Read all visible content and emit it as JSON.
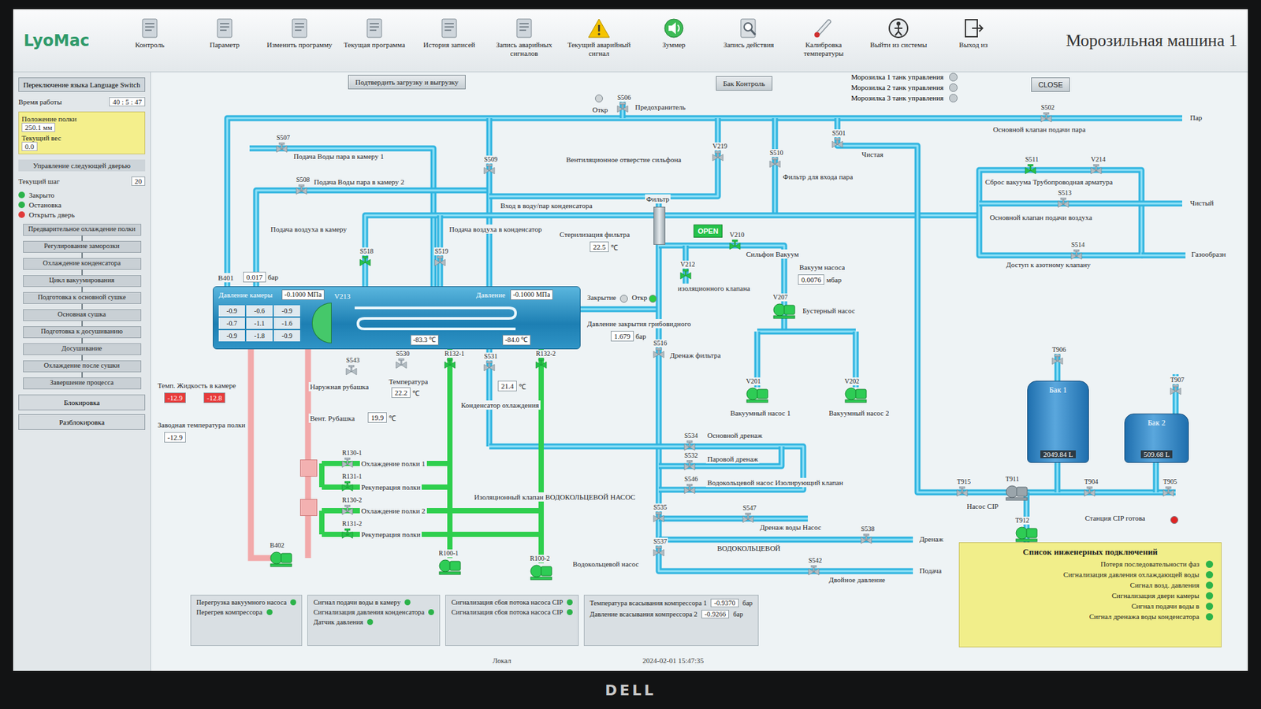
{
  "window": {
    "logo": "LyoMac",
    "title": "Морозильная машина 1"
  },
  "toolbar": [
    {
      "label": "Контроль",
      "kind": "doc"
    },
    {
      "label": "Параметр",
      "kind": "doc"
    },
    {
      "label": "Изменить программу",
      "kind": "doc"
    },
    {
      "label": "Текущая программа",
      "kind": "doc"
    },
    {
      "label": "История записей",
      "kind": "doc"
    },
    {
      "label": "Запись аварийных сигналов",
      "kind": "doc"
    },
    {
      "label": "Текущий аварийный сигнал",
      "kind": "warning"
    },
    {
      "label": "Зуммер",
      "kind": "speaker"
    },
    {
      "label": "Запись действия",
      "kind": "search"
    },
    {
      "label": "Калибровка температуры",
      "kind": "thermometer"
    },
    {
      "label": "Выйти из системы",
      "kind": "exit"
    },
    {
      "label": "Выход из",
      "kind": "door"
    }
  ],
  "controls": {
    "confirm": "Подтвердить загрузку и выгрузку",
    "tank_control": "Бак Контроль",
    "close": "CLOSE",
    "open_badge": "OPEN"
  },
  "tank_modes": [
    {
      "label": "Морозилка 1 танк управления",
      "selected": false
    },
    {
      "label": "Морозилка 2 танк управления",
      "selected": false
    },
    {
      "label": "Морозилка 3 танк управления",
      "selected": false
    }
  ],
  "left_panel": {
    "language": "Переключение языка Language Switch",
    "runtime_label": "Время работы",
    "runtime": "40 : 5 : 47",
    "info": [
      {
        "label": "Положение полки",
        "value": "250.1 мм"
      },
      {
        "label": "Текущий вес",
        "value": "0.0"
      }
    ],
    "section": "Управление следующей дверью",
    "current_step_label": "Текущий шаг",
    "current_step": "20",
    "lights": [
      {
        "label": "Закрыто",
        "color": "#2bb34a"
      },
      {
        "label": "Остановка",
        "color": "#2bb34a"
      },
      {
        "label": "Открыть дверь",
        "color": "#e03a3a"
      }
    ],
    "steps": [
      "Предварительное охлаждение полки",
      "Регулирование заморозки",
      "Охлаждение конденсатора",
      "Цикл вакуумирования",
      "Подготовка к основной сушке",
      "Основная сушка",
      "Подготовка к досушиванию",
      "Досушивание",
      "Охлаждение после сушки",
      "Завершение процесса"
    ],
    "lock": [
      "Блокировка",
      "Разблокировка"
    ]
  },
  "valves": [
    {
      "tag": "S506",
      "on": false
    },
    {
      "tag": "S502",
      "on": false
    },
    {
      "tag": "S501",
      "on": false
    },
    {
      "tag": "V219",
      "on": false
    },
    {
      "tag": "S510",
      "on": false
    },
    {
      "tag": "S511",
      "on": true
    },
    {
      "tag": "V214",
      "on": false
    },
    {
      "tag": "S513",
      "on": false
    },
    {
      "tag": "S514",
      "on": false
    },
    {
      "tag": "S507",
      "on": false
    },
    {
      "tag": "S508",
      "on": false
    },
    {
      "tag": "S509",
      "on": false
    },
    {
      "tag": "S518",
      "on": true
    },
    {
      "tag": "S519",
      "on": false
    },
    {
      "tag": "V210",
      "on": true
    },
    {
      "tag": "V212",
      "on": true
    },
    {
      "tag": "S516",
      "on": false
    },
    {
      "tag": "S530",
      "on": false
    },
    {
      "tag": "S531",
      "on": false
    },
    {
      "tag": "S543",
      "on": false
    },
    {
      "tag": "S534",
      "on": false
    },
    {
      "tag": "S532",
      "on": false
    },
    {
      "tag": "S546",
      "on": false
    },
    {
      "tag": "S535",
      "on": false
    },
    {
      "tag": "S547",
      "on": false
    },
    {
      "tag": "S537",
      "on": false
    },
    {
      "tag": "S538",
      "on": false
    },
    {
      "tag": "S542",
      "on": false
    },
    {
      "tag": "T906",
      "on": false
    },
    {
      "tag": "T907",
      "on": false
    },
    {
      "tag": "T915",
      "on": false
    },
    {
      "tag": "T904",
      "on": false
    },
    {
      "tag": "T905",
      "on": false
    },
    {
      "tag": "R130-1",
      "on": false
    },
    {
      "tag": "R131-1",
      "on": true
    },
    {
      "tag": "R130-2",
      "on": false
    },
    {
      "tag": "R131-2",
      "on": true
    },
    {
      "tag": "R132-1",
      "on": true
    },
    {
      "tag": "R132-2",
      "on": true
    }
  ],
  "pumps": [
    {
      "tag": "V207",
      "on": true
    },
    {
      "tag": "V201",
      "on": true
    },
    {
      "tag": "V202",
      "on": true
    },
    {
      "tag": "T911",
      "on": false
    },
    {
      "tag": "T912",
      "on": true
    },
    {
      "tag": "R100-1",
      "on": true
    },
    {
      "tag": "R100-2",
      "on": true
    },
    {
      "tag": "B402",
      "on": true
    }
  ],
  "labels": [
    "Откр",
    "Предохранитель",
    "Пар",
    "Основной клапан подачи пара",
    "Чистая",
    "Вентиляционное отверстие сильфона",
    "Фильтр для входа пара",
    "Сброс вакуума Трубопроводная арматура",
    "Основной клапан подачи воздуха",
    "Чистый",
    "Доступ к азотному клапану",
    "Газообразн",
    "Подача Воды пара в камеру 1",
    "Подача Воды пара в камеру 2",
    "Вход в воду/пар конденсатора",
    "Фильтр",
    "Подача воздуха в камеру",
    "Подача воздуха в конденсатор",
    "Стерилизация фильтра",
    "Сильфон Вакуум",
    "изоляционного клапана",
    "Вакуум насоса",
    "Бустерный насос",
    "Вакуумный насос 1",
    "Вакуумный насос 2",
    "Дренаж фильтра",
    "Давление закрытия грибовидного",
    "Закрытие",
    "Откр",
    "Температура",
    "Конденсатор охлаждения",
    "Наружная рубашка",
    "Вент. Рубашка",
    "Темп. Жидкость в камере",
    "Заводная температура полки",
    "Охлаждение полки 1",
    "Рекуперация полки",
    "Охлаждение полки 2",
    "Рекуперация полки",
    "Изоляционный клапан ВОДОКОЛЬЦЕВОЙ НАСОС",
    "Водокольцевой насос",
    "Основной дренаж",
    "Паровой дренаж",
    "Водокольцевой насос Изолирующий клапан",
    "Дренаж воды Насос",
    "ВОДОКОЛЬЦЕВОЙ",
    "Двойное давление",
    "Дренаж",
    "Подача",
    "Станция CIP готова",
    "Насос CIP",
    "B401"
  ],
  "readouts": [
    {
      "value": "22.5",
      "unit": "℃",
      "alarm": false
    },
    {
      "value": "0.0076",
      "unit": "мбар",
      "alarm": false
    },
    {
      "value": "1.679",
      "unit": "бар",
      "alarm": false
    },
    {
      "value": "22.2",
      "unit": "℃",
      "alarm": false
    },
    {
      "value": "21.4",
      "unit": "℃",
      "alarm": false
    },
    {
      "value": "19.9",
      "unit": "℃",
      "alarm": false
    },
    {
      "value": "-12.9",
      "unit": "",
      "alarm": true
    },
    {
      "value": "-12.8",
      "unit": "",
      "alarm": true
    },
    {
      "value": "-12.9",
      "unit": "",
      "alarm": false
    },
    {
      "value": "0.017",
      "unit": "бар",
      "alarm": false
    }
  ],
  "indicators": [
    {
      "color": "#cfd4d6"
    },
    {
      "color": "#cfd4d6"
    },
    {
      "color": "#2ecc40"
    },
    {
      "color": "#e02424"
    }
  ],
  "chamber": {
    "pressure_label": "Давление камеры",
    "pressure": {
      "value": "-0.1000",
      "unit": "МПа"
    },
    "valve": "V213",
    "cond_label": "Давление",
    "cond_pressure": {
      "value": "-0.1000",
      "unit": "МПа"
    },
    "temps": [
      "-0.9",
      "-0.6",
      "-0.9",
      "-0.7",
      "-1.1",
      "-1.6",
      "-0.9",
      "-1.8",
      "-0.9"
    ],
    "cond_temps": [
      {
        "value": "-83.3",
        "unit": "℃"
      },
      {
        "value": "-84.0",
        "unit": "℃"
      }
    ]
  },
  "tanks": [
    {
      "name": "Бак 1",
      "value": "2049.84",
      "unit": "L"
    },
    {
      "name": "Бак 2",
      "value": "509.68",
      "unit": "L"
    }
  ],
  "alarm_panels": [
    [
      {
        "text": "Перегрузка вакуумного насоса",
        "color": "#2cb34a"
      },
      {
        "text": "Перегрев компрессора",
        "color": "#2cb34a"
      }
    ],
    [
      {
        "text": "Сигнал подачи воды в камеру",
        "color": "#2cb34a"
      },
      {
        "text": "Сигнализация давления конденсатора",
        "color": "#2cb34a"
      },
      {
        "text": "Датчик давления",
        "color": "#2cb34a"
      }
    ],
    [
      {
        "text": "Сигнализация сбоя потока насоса CIP",
        "color": "#2cb34a"
      },
      {
        "text": "Сигнализация сбоя потока насоса CIP",
        "color": "#2cb34a"
      }
    ]
  ],
  "compressor": [
    {
      "label": "Температура всасывания компрессора 1",
      "value": "-0.9370",
      "unit": "бар"
    },
    {
      "label": "Давление всасывания компрессора 2",
      "value": "-0.9266",
      "unit": "бар"
    }
  ],
  "engineering": {
    "title": "Список инженерных подключений",
    "items": [
      {
        "text": "Потеря последовательности фаз",
        "color": "#2cb34a"
      },
      {
        "text": "Сигнализация давления охлаждающей воды",
        "color": "#2cb34a"
      },
      {
        "text": "Сигнал возд. давления",
        "color": "#2cb34a"
      },
      {
        "text": "Сигнализация двери камеры",
        "color": "#2cb34a"
      },
      {
        "text": "Сигнал подачи воды в",
        "color": "#2cb34a"
      },
      {
        "text": "Сигнал дренажа воды конденсатора",
        "color": "#2cb34a"
      }
    ]
  },
  "status": {
    "mode": "Локал",
    "time": "2024-02-01 15:47:35"
  },
  "brand": "DELL"
}
